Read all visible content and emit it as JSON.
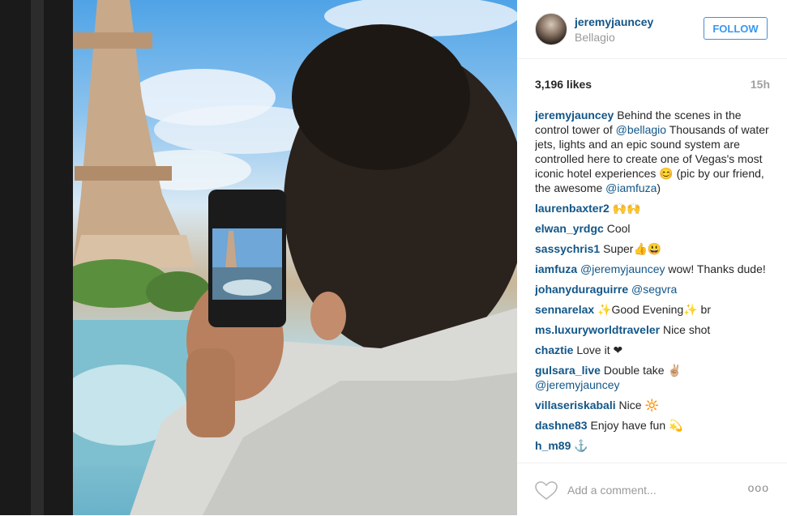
{
  "post": {
    "username": "jeremyjauncey",
    "location": "Bellagio",
    "follow_label": "FOLLOW",
    "likes": "3,196 likes",
    "time_ago": "15h"
  },
  "caption": {
    "username": "jeremyjauncey",
    "text_1": "Behind the scenes in the control tower of ",
    "mention": "@bellagio",
    "text_2": " Thousands of water jets, lights and an epic sound system are controlled here to create one of Vegas's most iconic hotel experiences ",
    "emoji": "😊",
    "text_3": " (pic by our friend, the awesome ",
    "mention_2": "@iamfuza",
    "text_4": ")"
  },
  "comments": [
    {
      "user": "laurenbaxter2",
      "text": "",
      "emoji": "🙌🙌"
    },
    {
      "user": "elwan_yrdgc",
      "text": "Cool",
      "emoji": ""
    },
    {
      "user": "sassychris1",
      "text": "Super",
      "emoji": "👍😃"
    },
    {
      "user": "iamfuza",
      "mention": "@jeremyjauncey",
      "text": " wow! Thanks dude!",
      "emoji": ""
    },
    {
      "user": "johanyduraguirre",
      "mention": "@segvra",
      "text": "",
      "emoji": ""
    },
    {
      "user": "sennarelax",
      "text": "Good Evening",
      "emoji_before": "✨",
      "emoji_after": "✨",
      "text_after": " br"
    },
    {
      "user": "ms.luxuryworldtraveler",
      "text": "Nice shot",
      "emoji": ""
    },
    {
      "user": "chaztie",
      "text": "Love it ",
      "emoji": "❤"
    },
    {
      "user": "gulsara_live",
      "text": "Double take ",
      "emoji": "✌🏼",
      "mention_after": "@jeremyjauncey"
    },
    {
      "user": "villaseriskabali",
      "text": "Nice ",
      "emoji": "🔆"
    },
    {
      "user": "dashne83",
      "text": "Enjoy have fun ",
      "emoji": "💫"
    },
    {
      "user": "h_m89",
      "text": "",
      "emoji": "⚓"
    }
  ],
  "footer": {
    "comment_placeholder": "Add a comment...",
    "more_label": "ooo"
  },
  "icons": {
    "like": "heart-icon",
    "options": "more-options-icon"
  },
  "colors": {
    "username_blue": "#125688",
    "follow_blue": "#3897f0",
    "muted_gray": "#9a9a9a"
  }
}
